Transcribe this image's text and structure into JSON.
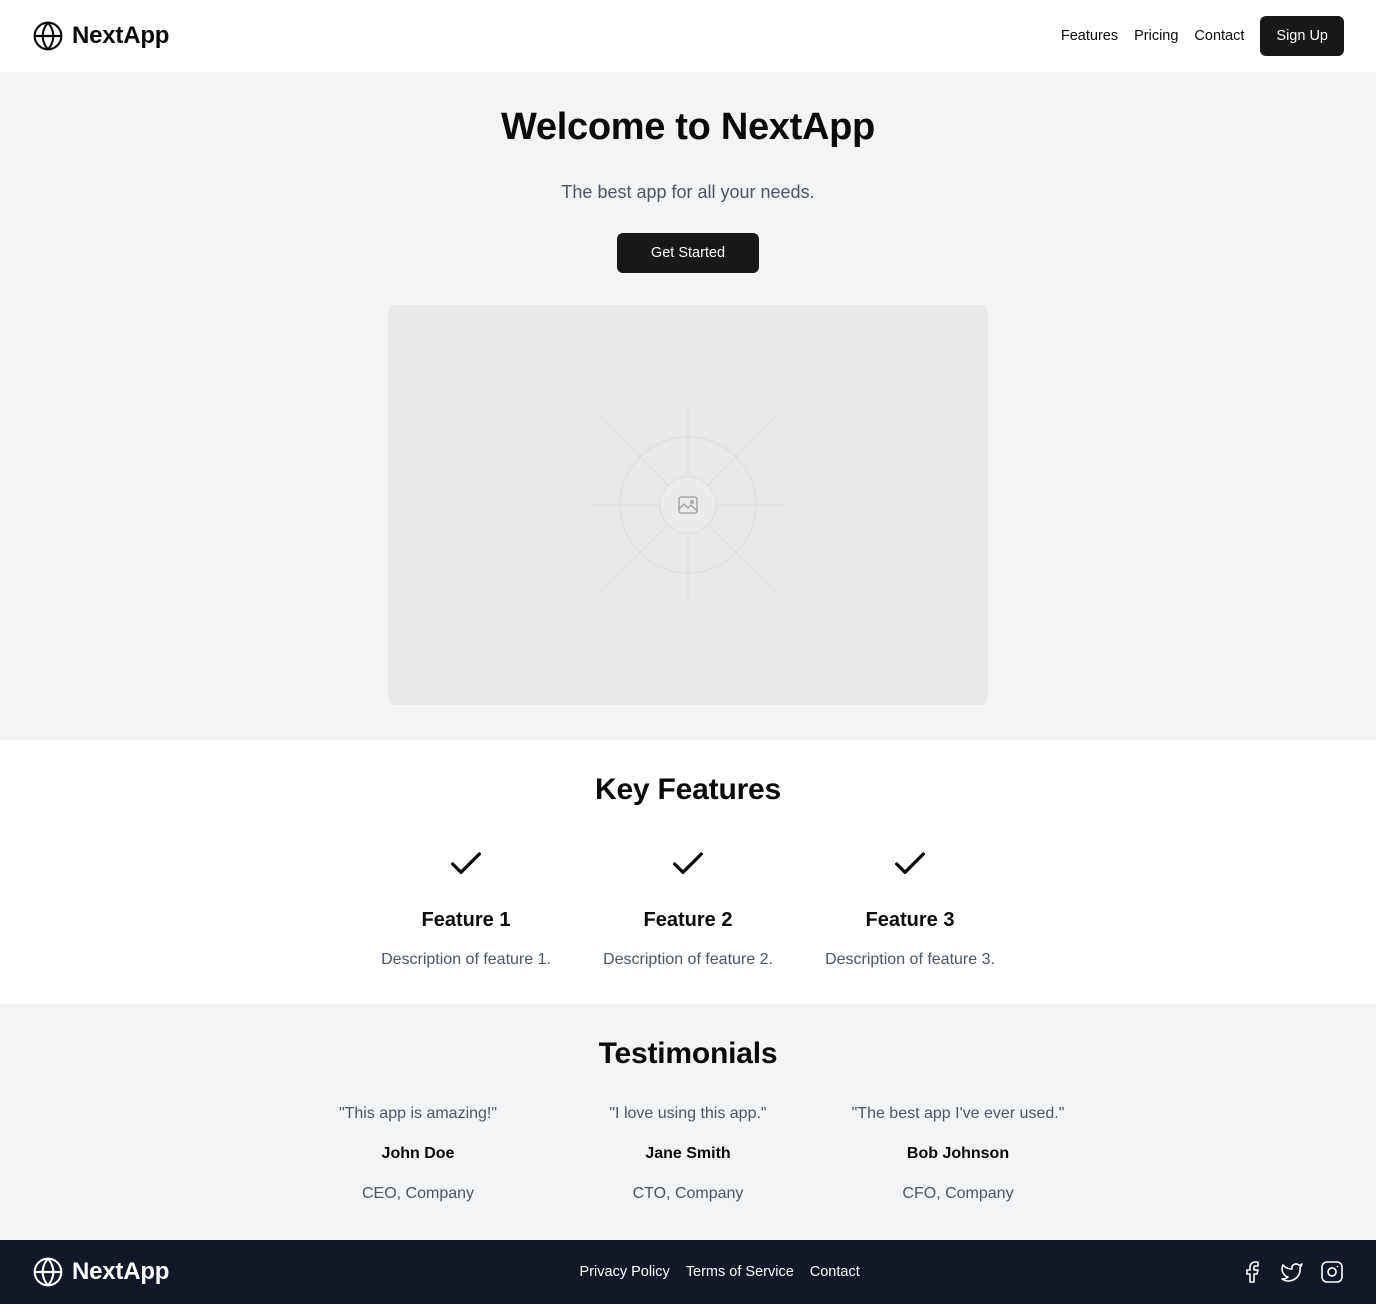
{
  "header": {
    "brand": "NextApp",
    "logo_icon": "globe-icon",
    "nav": [
      {
        "label": "Features"
      },
      {
        "label": "Pricing"
      },
      {
        "label": "Contact"
      }
    ],
    "signup_label": "Sign Up"
  },
  "hero": {
    "title": "Welcome to NextApp",
    "subtitle": "The best app for all your needs.",
    "cta_label": "Get Started",
    "image_icon": "image-placeholder-icon"
  },
  "features": {
    "title": "Key Features",
    "items": [
      {
        "title": "Feature 1",
        "description": "Description of feature 1.",
        "icon": "check-icon"
      },
      {
        "title": "Feature 2",
        "description": "Description of feature 2.",
        "icon": "check-icon"
      },
      {
        "title": "Feature 3",
        "description": "Description of feature 3.",
        "icon": "check-icon"
      }
    ]
  },
  "testimonials": {
    "title": "Testimonials",
    "items": [
      {
        "quote": "\"This app is amazing!\"",
        "name": "John Doe",
        "role": "CEO, Company"
      },
      {
        "quote": "\"I love using this app.\"",
        "name": "Jane Smith",
        "role": "CTO, Company"
      },
      {
        "quote": "\"The best app I've ever used.\"",
        "name": "Bob Johnson",
        "role": "CFO, Company"
      }
    ]
  },
  "footer": {
    "brand": "NextApp",
    "links": [
      {
        "label": "Privacy Policy"
      },
      {
        "label": "Terms of Service"
      },
      {
        "label": "Contact"
      }
    ],
    "socials": [
      "facebook-icon",
      "twitter-icon",
      "instagram-icon"
    ]
  },
  "colors": {
    "primary_dark": "#18181b",
    "section_gray": "#f3f4f6",
    "footer_bg": "#111827",
    "muted_text": "#4b5563"
  }
}
